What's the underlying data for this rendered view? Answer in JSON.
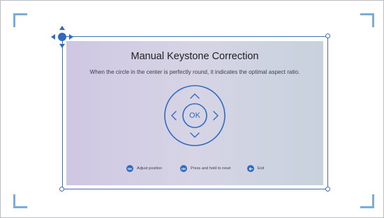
{
  "dialog": {
    "title": "Manual Keystone Correction",
    "description": "When the circle in the center is perfectly round, it indicates the optimal aspect ratio."
  },
  "dpad": {
    "ok_label": "OK"
  },
  "legend": [
    {
      "icon": "ok-icon",
      "icon_text": "OK",
      "label": "Adjust position"
    },
    {
      "icon": "ok-icon",
      "icon_text": "OK",
      "label": "Press and hold to reset"
    },
    {
      "icon": "back-arrow-icon",
      "icon_text": "",
      "label": "Exit"
    }
  ],
  "colors": {
    "accent": "#2f6bbf",
    "frame": "#3f6fb5",
    "corner_brackets": "#7aaed8",
    "panel_left": "#cfc7e3",
    "panel_right": "#c8d2dd"
  }
}
